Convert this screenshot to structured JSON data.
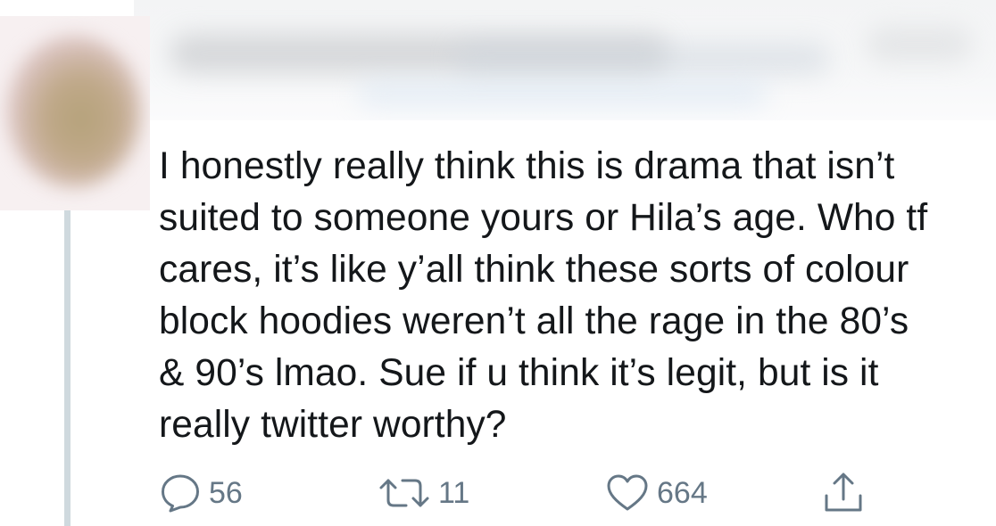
{
  "tweet": {
    "text_lines": [
      "I honestly really think this is drama that isn’t",
      "suited to someone yours or Hila’s age. Who tf",
      "cares, it’s like y’all think these sorts of colour",
      "block hoodies weren’t all the rage in the 80’s",
      "& 90’s lmao. Sue if u think it’s legit, but is it",
      "really twitter worthy?"
    ]
  },
  "actions": {
    "reply": {
      "icon": "reply-icon",
      "count": "56"
    },
    "retweet": {
      "icon": "retweet-icon",
      "count": "11"
    },
    "like": {
      "icon": "heart-icon",
      "count": "664"
    },
    "share": {
      "icon": "share-icon"
    }
  },
  "colors": {
    "text": "#14171a",
    "icon": "#657786",
    "thread_line": "#cfd9de"
  }
}
